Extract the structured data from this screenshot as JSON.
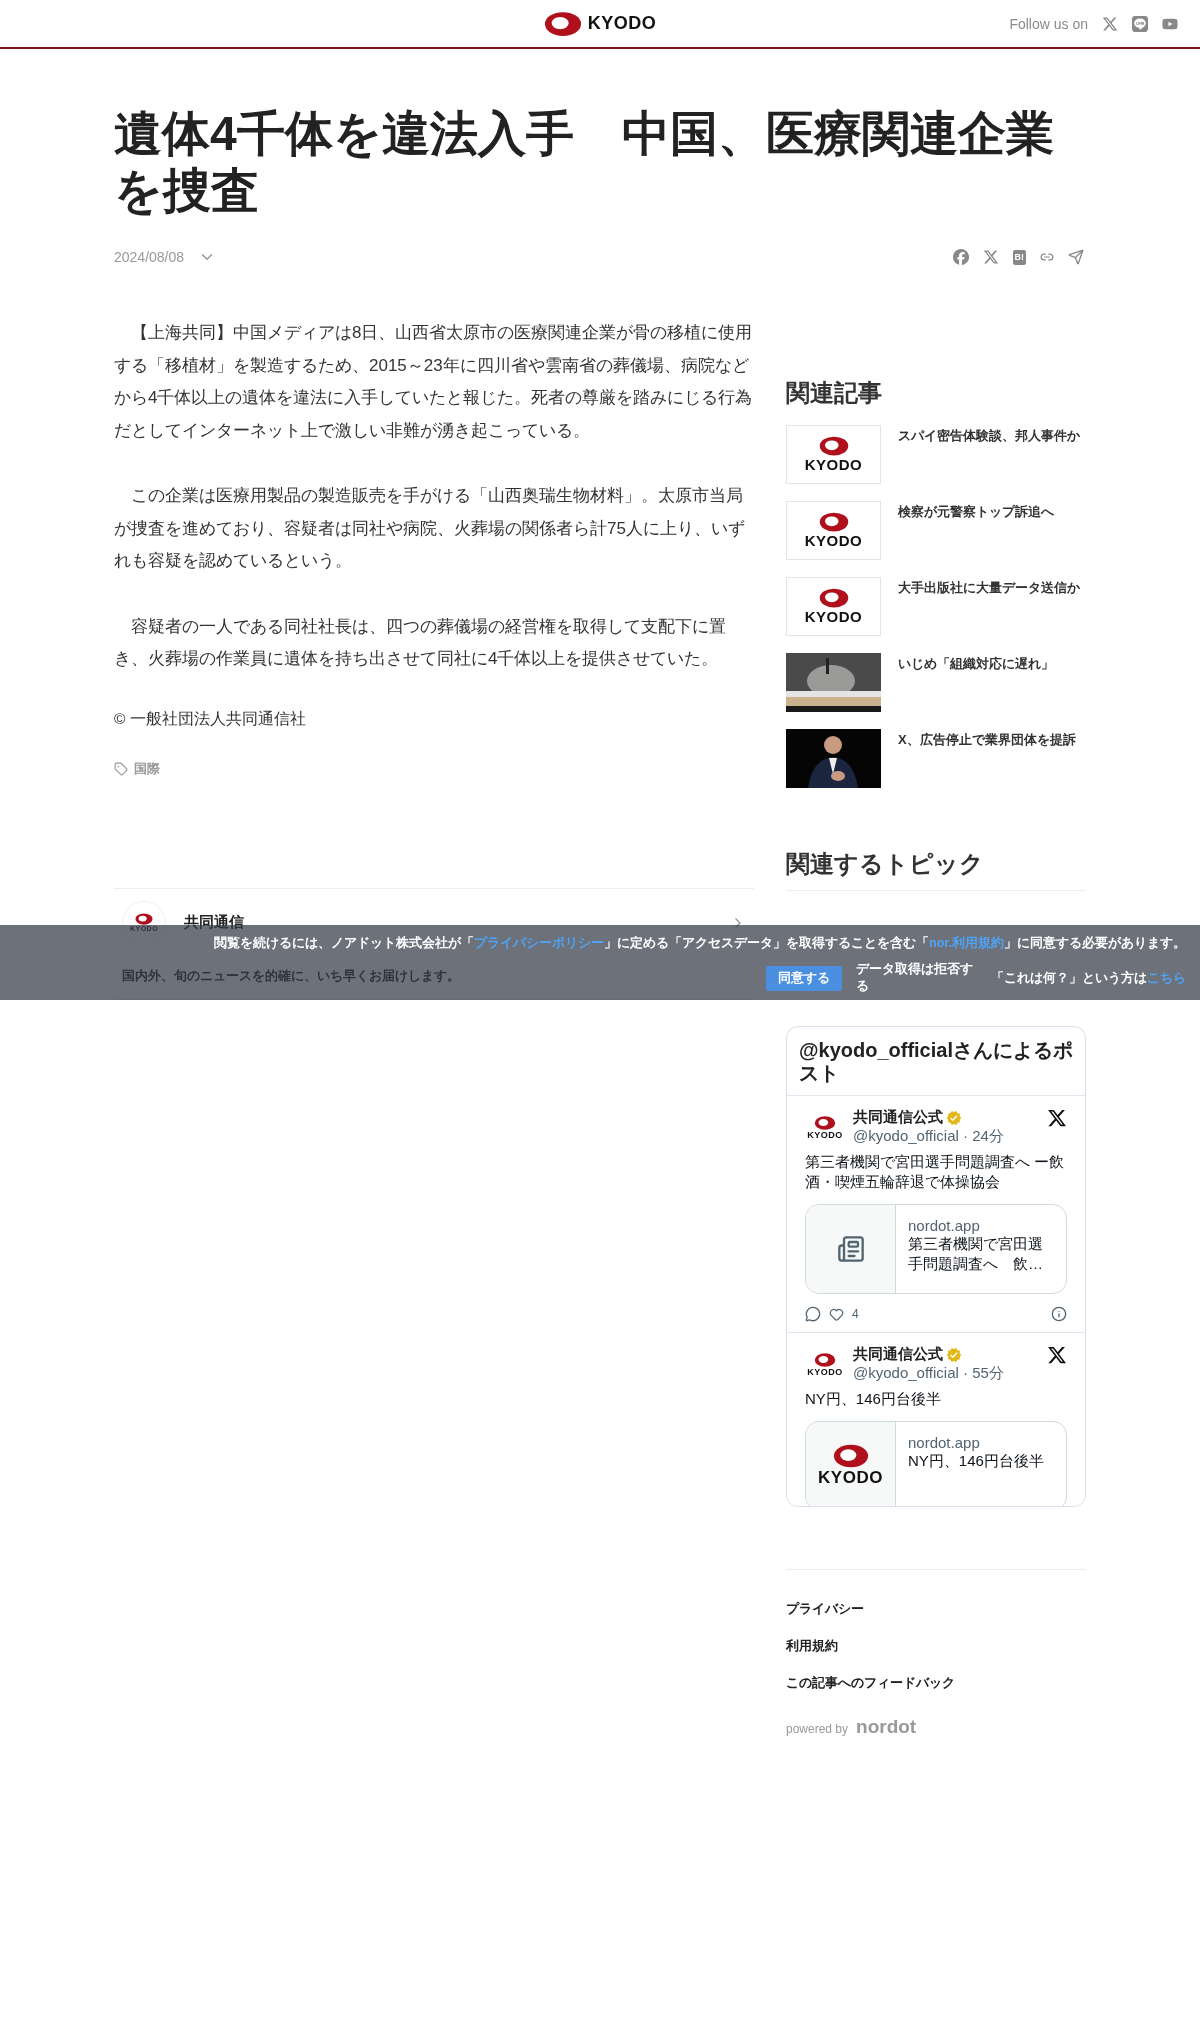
{
  "header": {
    "logo_text": "KYODO",
    "follow_label": "Follow us on"
  },
  "article": {
    "title": "遺体4千体を違法入手　中国、医療関連企業を捜査",
    "date": "2024/08/08",
    "share": {
      "hatena_label": "B!"
    },
    "paragraphs": [
      "　【上海共同】中国メディアは8日、山西省太原市の医療関連企業が骨の移植に使用する「移植材」を製造するため、2015～23年に四川省や雲南省の葬儀場、病院などから4千体以上の遺体を違法に入手していたと報じた。死者の尊厳を踏みにじる行為だとしてインターネット上で激しい非難が湧き起こっている。",
      "　この企業は医療用製品の製造販売を手がける「山西奥瑞生物材料」。太原市当局が捜査を進めており、容疑者は同社や病院、火葬場の関係者ら計75人に上り、いずれも容疑を認めているという。",
      "　容疑者の一人である同社社長は、四つの葬儀場の経営権を取得して支配下に置き、火葬場の作業員に遺体を持ち出させて同社に4千体以上を提供させていた。"
    ],
    "copyright": "© 一般社団法人共同通信社",
    "tags": [
      "国際"
    ]
  },
  "publisher": {
    "logo_text": "KYODO",
    "name": "共同通信",
    "description": "国内外、旬のニュースを的確に、いち早くお届けします。"
  },
  "related": {
    "heading": "関連記事",
    "items": [
      {
        "kind": "logo",
        "logo_text": "KYODO",
        "title": "スパイ密告体験談、邦人事件か"
      },
      {
        "kind": "logo",
        "logo_text": "KYODO",
        "title": "検察が元警察トップ訴追へ"
      },
      {
        "kind": "logo",
        "logo_text": "KYODO",
        "title": "大手出版社に大量データ送信か"
      },
      {
        "kind": "picture",
        "title": "いじめ「組織対応に遅れ」"
      },
      {
        "kind": "picture",
        "title": "X、広告停止で業界団体を提訴"
      }
    ]
  },
  "topics": {
    "heading": "関連するトピック"
  },
  "timeline": {
    "title": "@kyodo_officialさんによるポスト",
    "posts": [
      {
        "avatar_text": "KYODO",
        "name": "共同通信公式",
        "handle": "@kyodo_official · 24分",
        "text": "第三者機関で宮田選手問題調査へ ー飲酒・喫煙五輪辞退で体操協会",
        "card": {
          "kind": "placeholder",
          "domain": "nordot.app",
          "title": "第三者機関で宮田選手問題調査へ　飲…"
        },
        "likes": "4"
      },
      {
        "avatar_text": "KYODO",
        "name": "共同通信公式",
        "handle": "@kyodo_official · 55分",
        "text": "NY円、146円台後半",
        "card": {
          "kind": "logo",
          "logo_text": "KYODO",
          "domain": "nordot.app",
          "title": "NY円、146円台後半"
        }
      }
    ]
  },
  "footer": {
    "links": [
      "プライバシー",
      "利用規約",
      "この記事へのフィードバック"
    ],
    "powered_by": "powered by",
    "brand": "nordot"
  },
  "consent_banner": {
    "message": [
      {
        "kind": "text",
        "text": "閲覧を続けるには、ノアドット株式会社が「"
      },
      {
        "kind": "link",
        "text": "プライバシーポリシー"
      },
      {
        "kind": "text",
        "text": "」に定める「アクセスデータ」を取得することを含む「"
      },
      {
        "kind": "link",
        "text": "nor.利用規約"
      },
      {
        "kind": "text",
        "text": "」に同意する必要があります。"
      }
    ],
    "accept": "同意する",
    "decline": "データ取得は拒否する",
    "help_text": "「これは何？」という方は",
    "help_link": "こちら"
  }
}
